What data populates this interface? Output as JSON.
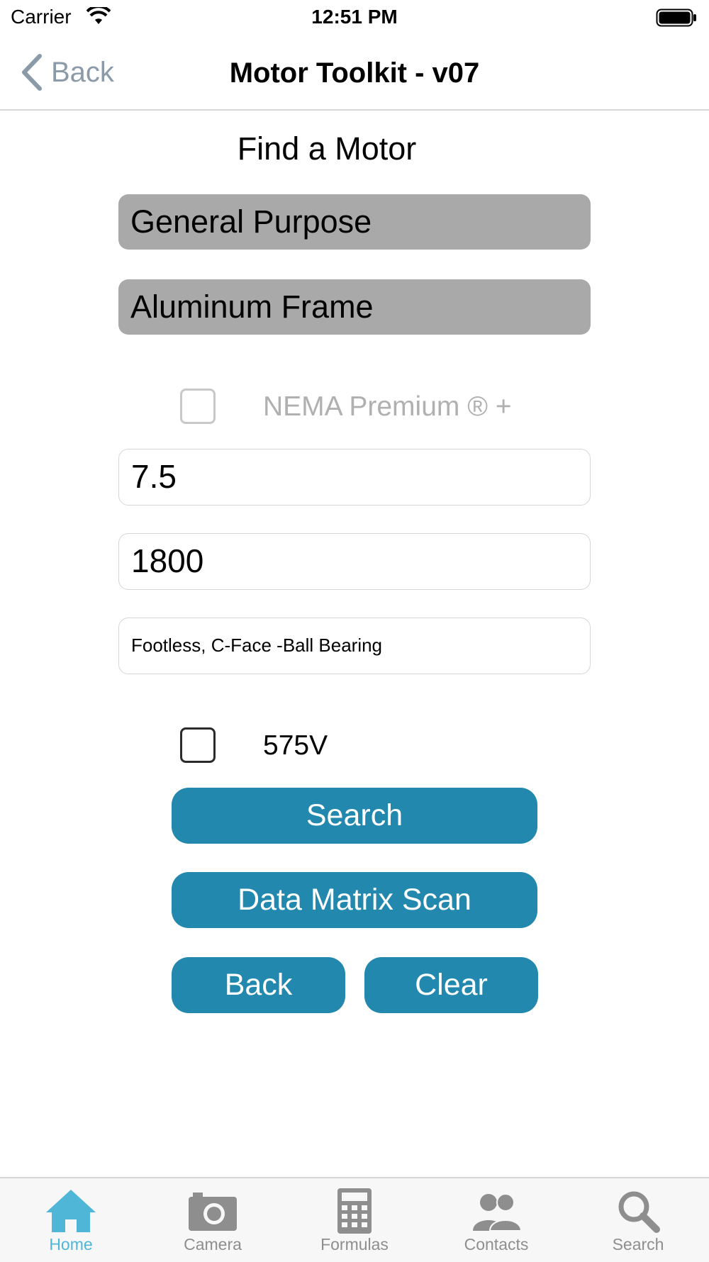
{
  "status_bar": {
    "carrier": "Carrier",
    "time": "12:51 PM"
  },
  "nav": {
    "back_label": "Back",
    "title": "Motor Toolkit - v07"
  },
  "form": {
    "heading": "Find a Motor",
    "category_select": "General Purpose",
    "frame_select": "Aluminum Frame",
    "nema_premium_label": "NEMA Premium ® +",
    "nema_premium_checked": false,
    "hp_value": "7.5",
    "rpm_value": "1800",
    "mounting_value": "Footless, C-Face -Ball Bearing",
    "voltage_label": "575V",
    "voltage_checked": false
  },
  "buttons": {
    "search": "Search",
    "data_matrix_scan": "Data Matrix Scan",
    "back": "Back",
    "clear": "Clear"
  },
  "tabs": [
    {
      "label": "Home",
      "icon": "home-icon",
      "active": true
    },
    {
      "label": "Camera",
      "icon": "camera-icon",
      "active": false
    },
    {
      "label": "Formulas",
      "icon": "calculator-icon",
      "active": false
    },
    {
      "label": "Contacts",
      "icon": "contacts-icon",
      "active": false
    },
    {
      "label": "Search",
      "icon": "search-icon",
      "active": false
    }
  ],
  "colors": {
    "accent": "#2388ae",
    "tab_active": "#4fb6d8",
    "tab_inactive": "#8e8e8e",
    "field_gray": "#a9a9a9"
  }
}
